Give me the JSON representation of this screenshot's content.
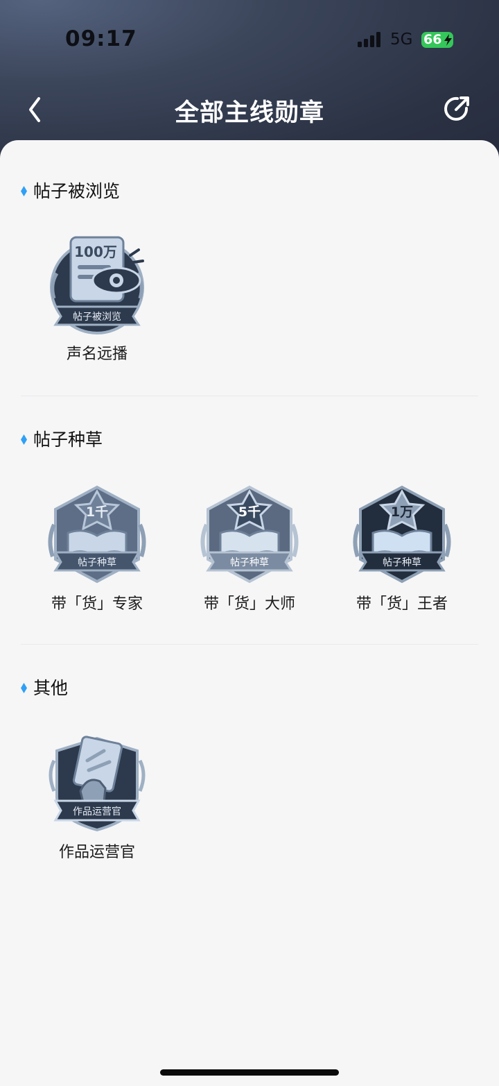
{
  "status": {
    "time": "09:17",
    "network": "5G",
    "battery": "66"
  },
  "nav": {
    "title": "全部主线勋章"
  },
  "colors": {
    "accent": "#2fa0f5",
    "header_dark": "#2b3244",
    "battery_green": "#34c759"
  },
  "icons": {
    "back": "chevron-left-icon",
    "share": "share-icon"
  },
  "sections": [
    {
      "title": "帖子被浏览",
      "badges": [
        {
          "icon_text": "100万",
          "ribbon": "帖子被浏览",
          "name": "声名远播"
        }
      ]
    },
    {
      "title": "帖子种草",
      "badges": [
        {
          "icon_text": "1千",
          "ribbon": "帖子种草",
          "name": "带「货」专家"
        },
        {
          "icon_text": "5千",
          "ribbon": "帖子种草",
          "name": "带「货」大师"
        },
        {
          "icon_text": "1万",
          "ribbon": "帖子种草",
          "name": "带「货」王者"
        }
      ]
    },
    {
      "title": "其他",
      "badges": [
        {
          "ribbon": "作品运营官",
          "name": "作品运营官"
        }
      ]
    }
  ]
}
